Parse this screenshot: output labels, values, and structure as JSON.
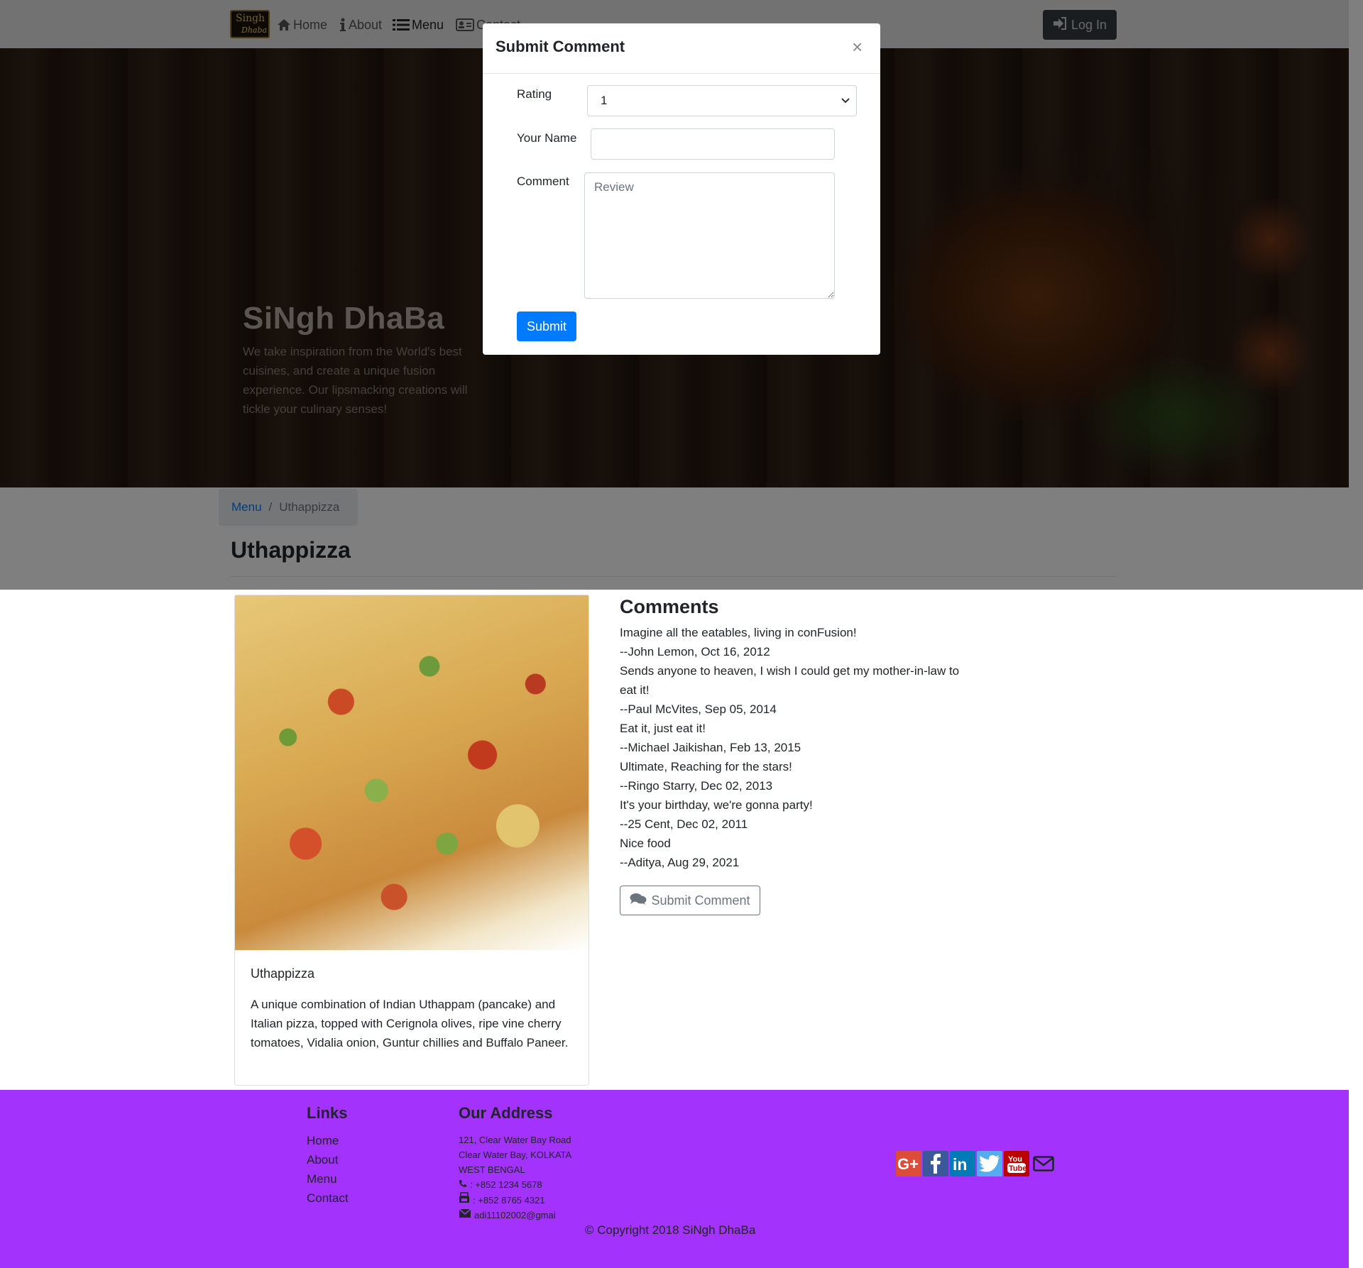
{
  "colors": {
    "primary": "#007bff",
    "footer_bg": "#a232fc",
    "dark_button": "#343a40",
    "google": "#dd4b39",
    "facebook": "#3b5998",
    "linkedin": "#007bb6",
    "twitter": "#55acee",
    "youtube": "#bb0000"
  },
  "navbar": {
    "logo_line1": "Singh",
    "logo_line2": "Dhaba",
    "items": [
      {
        "label": "Home",
        "icon": "home-icon"
      },
      {
        "label": "About",
        "icon": "info-icon"
      },
      {
        "label": "Menu",
        "icon": "list-icon"
      },
      {
        "label": "Contact",
        "icon": "address-card-icon"
      }
    ],
    "login_label": "Log In",
    "login_icon": "sign-in-icon"
  },
  "hero": {
    "title": "SiNgh DhaBa",
    "text": "We take inspiration from the World's best cuisines, and create a unique fusion experience. Our lipsmacking creations will tickle your culinary senses!"
  },
  "breadcrumb": {
    "link": "Menu",
    "separator": "/",
    "active": "Uthappizza"
  },
  "page": {
    "heading": "Uthappizza"
  },
  "dish": {
    "name": "Uthappizza",
    "description": "A unique combination of Indian Uthappam (pancake) and Italian pizza, topped with Cerignola olives, ripe vine cherry tomatoes, Vidalia onion, Guntur chillies and Buffalo Paneer."
  },
  "comments": {
    "title": "Comments",
    "items": [
      {
        "text": "Imagine all the eatables, living in conFusion!",
        "meta": "--John Lemon, Oct 16, 2012"
      },
      {
        "text": "Sends anyone to heaven, I wish I could get my mother-in-law to eat it!",
        "meta": "--Paul McVites, Sep 05, 2014"
      },
      {
        "text": "Eat it, just eat it!",
        "meta": "--Michael Jaikishan, Feb 13, 2015"
      },
      {
        "text": "Ultimate, Reaching for the stars!",
        "meta": "--Ringo Starry, Dec 02, 2013"
      },
      {
        "text": "It's your birthday, we're gonna party!",
        "meta": "--25 Cent, Dec 02, 2011"
      },
      {
        "text": "Nice food",
        "meta": "--Aditya, Aug 29, 2021"
      }
    ],
    "submit_label": "Submit Comment",
    "submit_icon": "comments-icon"
  },
  "modal": {
    "title": "Submit Comment",
    "close": "×",
    "rating_label": "Rating",
    "rating_value": "1",
    "name_label": "Your Name",
    "name_value": "",
    "comment_label": "Comment",
    "comment_placeholder": "Review",
    "submit_label": "Submit"
  },
  "footer": {
    "links_title": "Links",
    "links": [
      "Home",
      "About",
      "Menu",
      "Contact"
    ],
    "address_title": "Our Address",
    "address_lines": [
      "121, Clear Water Bay Road",
      "Clear Water Bay, KOLKATA",
      "WEST BENGAL"
    ],
    "phone": ": +852 1234 5678",
    "fax": ": +852 8765 4321",
    "email": "adi11102002@gmai",
    "social": [
      "google-plus-icon",
      "facebook-icon",
      "linkedin-icon",
      "twitter-icon",
      "youtube-icon",
      "envelope-icon"
    ],
    "copyright": "© Copyright 2018 SiNgh DhaBa"
  }
}
